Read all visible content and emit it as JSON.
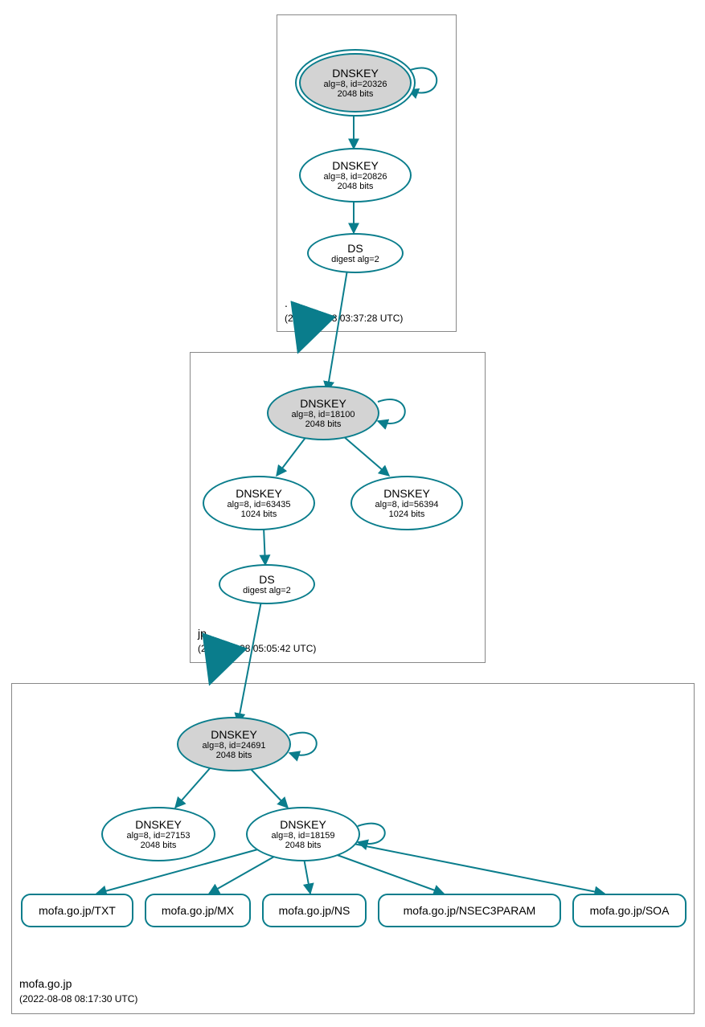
{
  "chart_data": {
    "type": "graph",
    "zones": [
      {
        "name": ".",
        "timestamp": "(2022-08-08 03:37:28 UTC)",
        "nodes": [
          {
            "id": "root-ksk",
            "type": "DNSKEY",
            "alg": "alg=8, id=20326",
            "bits": "2048 bits",
            "trustAnchor": true
          },
          {
            "id": "root-zsk",
            "type": "DNSKEY",
            "alg": "alg=8, id=20826",
            "bits": "2048 bits"
          },
          {
            "id": "root-ds",
            "type": "DS",
            "alg": "digest alg=2"
          }
        ]
      },
      {
        "name": "jp",
        "timestamp": "(2022-08-08 05:05:42 UTC)",
        "nodes": [
          {
            "id": "jp-ksk",
            "type": "DNSKEY",
            "alg": "alg=8, id=18100",
            "bits": "2048 bits",
            "sep": true
          },
          {
            "id": "jp-zsk1",
            "type": "DNSKEY",
            "alg": "alg=8, id=63435",
            "bits": "1024 bits"
          },
          {
            "id": "jp-zsk2",
            "type": "DNSKEY",
            "alg": "alg=8, id=56394",
            "bits": "1024 bits"
          },
          {
            "id": "jp-ds",
            "type": "DS",
            "alg": "digest alg=2"
          }
        ]
      },
      {
        "name": "mofa.go.jp",
        "timestamp": "(2022-08-08 08:17:30 UTC)",
        "nodes": [
          {
            "id": "mofa-ksk",
            "type": "DNSKEY",
            "alg": "alg=8, id=24691",
            "bits": "2048 bits",
            "sep": true
          },
          {
            "id": "mofa-zsk1",
            "type": "DNSKEY",
            "alg": "alg=8, id=27153",
            "bits": "2048 bits"
          },
          {
            "id": "mofa-zsk2",
            "type": "DNSKEY",
            "alg": "alg=8, id=18159",
            "bits": "2048 bits"
          }
        ],
        "records": [
          "mofa.go.jp/TXT",
          "mofa.go.jp/MX",
          "mofa.go.jp/NS",
          "mofa.go.jp/NSEC3PARAM",
          "mofa.go.jp/SOA"
        ]
      }
    ],
    "edges": [
      {
        "from": "root-ksk",
        "to": "root-ksk",
        "self": true
      },
      {
        "from": "root-ksk",
        "to": "root-zsk"
      },
      {
        "from": "root-zsk",
        "to": "root-ds"
      },
      {
        "from": "root-ds",
        "to": "jp-ksk"
      },
      {
        "from": "jp-ksk",
        "to": "jp-ksk",
        "self": true
      },
      {
        "from": "jp-ksk",
        "to": "jp-zsk1"
      },
      {
        "from": "jp-ksk",
        "to": "jp-zsk2"
      },
      {
        "from": "jp-zsk1",
        "to": "jp-ds"
      },
      {
        "from": "jp-ds",
        "to": "mofa-ksk"
      },
      {
        "from": "mofa-ksk",
        "to": "mofa-ksk",
        "self": true
      },
      {
        "from": "mofa-ksk",
        "to": "mofa-zsk1"
      },
      {
        "from": "mofa-ksk",
        "to": "mofa-zsk2"
      },
      {
        "from": "mofa-zsk2",
        "to": "mofa-zsk2",
        "self": true
      },
      {
        "from": "mofa-zsk2",
        "to": "mofa.go.jp/TXT"
      },
      {
        "from": "mofa-zsk2",
        "to": "mofa.go.jp/MX"
      },
      {
        "from": "mofa-zsk2",
        "to": "mofa.go.jp/NS"
      },
      {
        "from": "mofa-zsk2",
        "to": "mofa.go.jp/NSEC3PARAM"
      },
      {
        "from": "mofa-zsk2",
        "to": "mofa.go.jp/SOA"
      }
    ]
  },
  "labels": {
    "dnskey": "DNSKEY",
    "ds": "DS"
  }
}
